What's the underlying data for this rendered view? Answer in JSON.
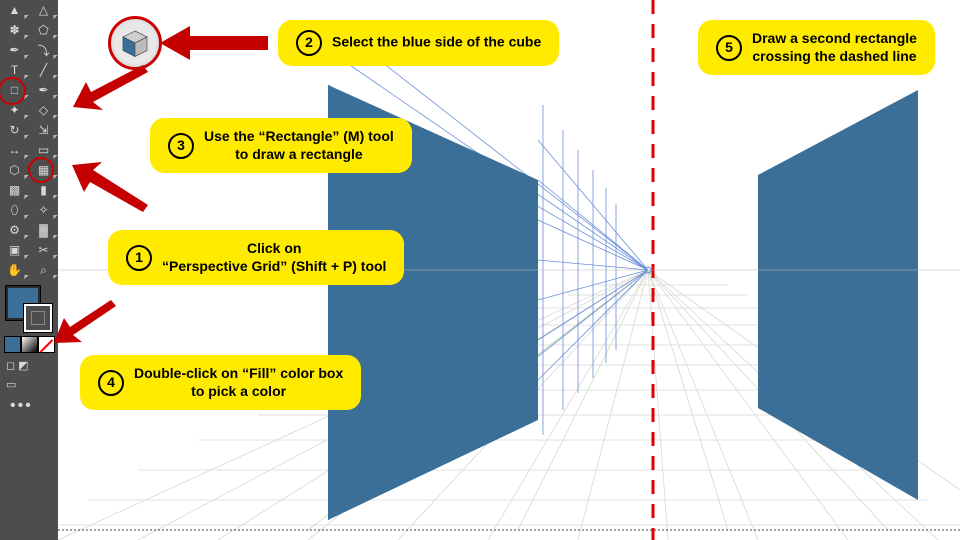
{
  "callouts": {
    "c1": {
      "num": "1",
      "text": "Click on\n“Perspective Grid” (Shift + P) tool"
    },
    "c2": {
      "num": "2",
      "text": "Select the blue side of the cube"
    },
    "c3": {
      "num": "3",
      "text": "Use the “Rectangle” (M) tool\nto draw a rectangle"
    },
    "c4": {
      "num": "4",
      "text": "Double-click on “Fill” color box\nto pick a color"
    },
    "c5": {
      "num": "5",
      "text": "Draw a second rectangle\ncrossing the dashed line"
    }
  },
  "colors": {
    "wall": "#3c6f97",
    "accent": "#ffeb00",
    "red": "#cc0000"
  },
  "tool_names": [
    "selection-tool",
    "direct-selection-tool",
    "magic-wand-tool",
    "lasso-tool",
    "pen-tool",
    "curvature-tool",
    "type-tool",
    "line-segment-tool",
    "rectangle-tool",
    "paintbrush-tool",
    "shaper-tool",
    "eraser-tool",
    "rotate-tool",
    "scale-tool",
    "width-tool",
    "free-transform-tool",
    "shape-builder-tool",
    "perspective-grid-tool",
    "mesh-tool",
    "gradient-tool",
    "eyedropper-tool",
    "blend-tool",
    "symbol-sprayer-tool",
    "column-graph-tool",
    "artboard-tool",
    "slice-tool",
    "hand-tool",
    "zoom-tool"
  ],
  "tool_glyphs": [
    "▲",
    "△",
    "✽",
    "⬠",
    "✒",
    "⤵",
    "T",
    "╱",
    "□",
    "✒",
    "✦",
    "◇",
    "↻",
    "⇲",
    "↔",
    "▭",
    "⬡",
    "▦",
    "▩",
    "▮",
    "⬯",
    "✧",
    "⚙",
    "▓",
    "▣",
    "✂",
    "✋",
    "⌕"
  ]
}
